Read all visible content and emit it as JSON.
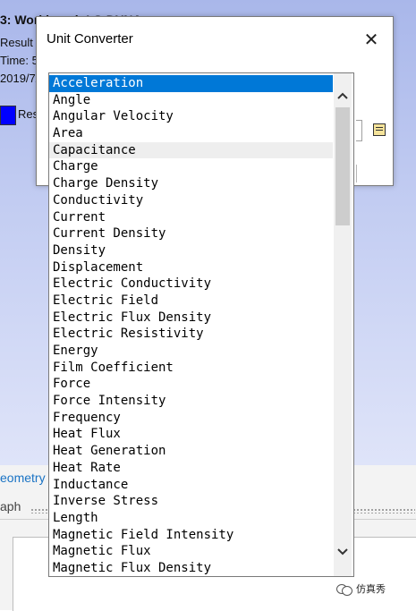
{
  "background": {
    "title": "3: Workbench LS-DYNA",
    "line1": "Result T",
    "line2": "Time: 5:",
    "line3": "2019/7/",
    "legend_label": "Res",
    "tab_geometry": "eometry",
    "tab_graph": "aph",
    "watermark": "仿真秀"
  },
  "dialog": {
    "title": "Unit Converter",
    "close_symbol": "✕"
  },
  "dropdown": {
    "items": [
      "Acceleration",
      "Angle",
      "Angular Velocity",
      "Area",
      "Capacitance",
      "Charge",
      "Charge Density",
      "Conductivity",
      "Current",
      "Current Density",
      "Density",
      "Displacement",
      "Electric Conductivity",
      "Electric Field",
      "Electric Flux Density",
      "Electric Resistivity",
      "Energy",
      "Film Coefficient",
      "Force",
      "Force Intensity",
      "Frequency",
      "Heat Flux",
      "Heat Generation",
      "Heat Rate",
      "Inductance",
      "Inverse Stress",
      "Length",
      "Magnetic Field Intensity",
      "Magnetic Flux",
      "Magnetic Flux Density"
    ],
    "selected": "Acceleration",
    "hovered": "Capacitance"
  },
  "colors": {
    "selection": "#0078d7",
    "legend_swatch": "#0000ff",
    "tab_link": "#1a73c4"
  },
  "icons": {
    "close": "close-icon",
    "scroll_up": "chevron-up-icon",
    "scroll_down": "chevron-down-icon",
    "dialog_button": "list-icon",
    "watermark": "wechat-icon"
  }
}
